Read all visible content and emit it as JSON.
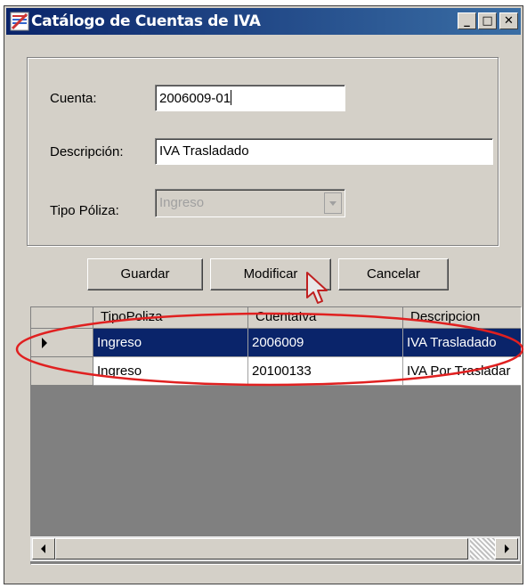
{
  "window": {
    "title": "Catálogo de Cuentas de IVA",
    "minimize": "_",
    "maximize": "□",
    "close": "✕"
  },
  "form": {
    "cuenta_label": "Cuenta:",
    "cuenta_value": "2006009-01",
    "descripcion_label": "Descripción:",
    "descripcion_value": "IVA Trasladado",
    "tipo_label": "Tipo Póliza:",
    "tipo_value": "Ingreso"
  },
  "buttons": {
    "guardar": "Guardar",
    "modificar": "Modificar",
    "cancelar": "Cancelar"
  },
  "grid": {
    "columns": [
      "TipoPoliza",
      "CuentaIva",
      "Descripcion"
    ],
    "rows": [
      [
        "Ingreso",
        "2006009",
        "IVA Trasladado"
      ],
      [
        "Ingreso",
        "20100133",
        "IVA Por Trasladar"
      ]
    ],
    "selected_row": 0
  },
  "colors": {
    "selection": "#0a246a",
    "annotation": "#e02020"
  }
}
